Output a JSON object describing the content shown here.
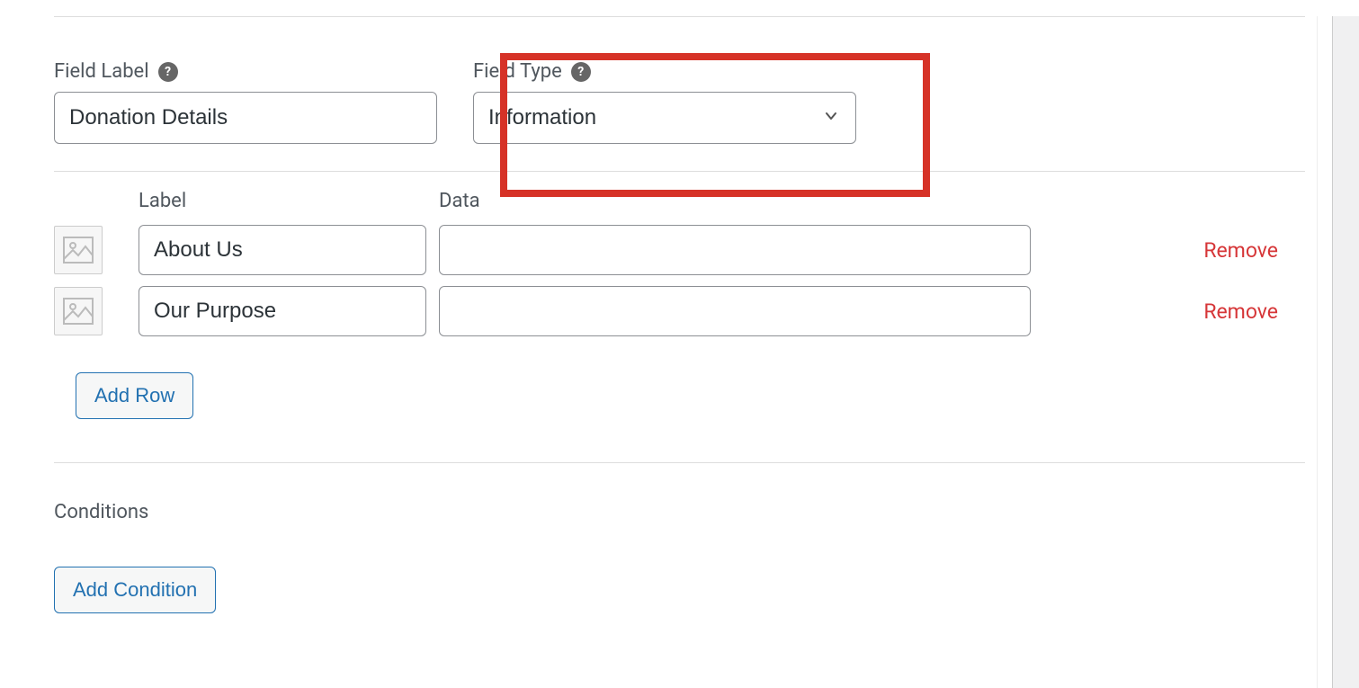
{
  "field_label": {
    "label": "Field Label",
    "value": "Donation Details"
  },
  "field_type": {
    "label": "Field Type",
    "value": "Information"
  },
  "rows": {
    "headers": {
      "label": "Label",
      "data": "Data"
    },
    "items": [
      {
        "label": "About Us",
        "data": "",
        "remove": "Remove"
      },
      {
        "label": "Our Purpose",
        "data": "",
        "remove": "Remove"
      }
    ],
    "add_button": "Add Row"
  },
  "conditions": {
    "label": "Conditions",
    "add_button": "Add Condition"
  }
}
